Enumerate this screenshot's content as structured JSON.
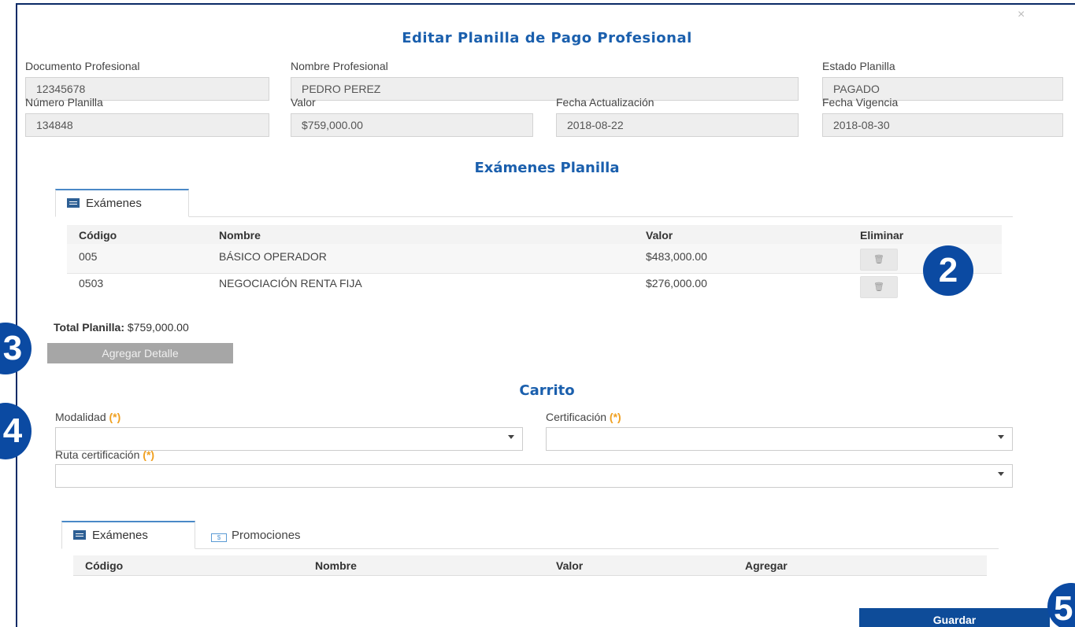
{
  "modal": {
    "close_glyph": "×",
    "title": "Editar Planilla de Pago Profesional"
  },
  "form": {
    "documento": {
      "label": "Documento Profesional",
      "value": "12345678"
    },
    "nombre": {
      "label": "Nombre Profesional",
      "value": "PEDRO  PEREZ"
    },
    "estado": {
      "label": "Estado Planilla",
      "value": "PAGADO"
    },
    "numero": {
      "label": "Número Planilla",
      "value": "134848"
    },
    "valor": {
      "label": "Valor",
      "value": "$759,000.00"
    },
    "fecha_act": {
      "label": "Fecha Actualización",
      "value": "2018-08-22"
    },
    "fecha_vig": {
      "label": "Fecha Vigencia",
      "value": "2018-08-30"
    }
  },
  "examenes_planilla": {
    "section_title": "Exámenes Planilla",
    "tab_label": "Exámenes",
    "columns": [
      "Código",
      "Nombre",
      "Valor",
      "Eliminar"
    ],
    "rows": [
      {
        "codigo": "005",
        "nombre": "BÁSICO OPERADOR",
        "valor": "$483,000.00"
      },
      {
        "codigo": "0503",
        "nombre": "NEGOCIACIÓN RENTA FIJA",
        "valor": "$276,000.00"
      }
    ],
    "trash_glyph": "🗑",
    "total_label": "Total Planilla:",
    "total_value": "$759,000.00",
    "add_button": "Agregar Detalle"
  },
  "carrito": {
    "section_title": "Carrito",
    "modalidad_label": "Modalidad",
    "certificacion_label": "Certificación",
    "ruta_label": "Ruta certificación",
    "required_mark": "(*)",
    "tabs": [
      {
        "label": "Exámenes"
      },
      {
        "label": "Promociones"
      }
    ],
    "promo_icon_text": "$",
    "columns": [
      "Código",
      "Nombre",
      "Valor",
      "Agregar"
    ]
  },
  "footer": {
    "save_button": "Guardar"
  },
  "badges": [
    "2",
    "3",
    "4",
    "5"
  ],
  "colors": {
    "accent": "#1a5fad",
    "badge": "#0b4aa2",
    "save": "#0e4c99",
    "required": "#f0a020"
  }
}
